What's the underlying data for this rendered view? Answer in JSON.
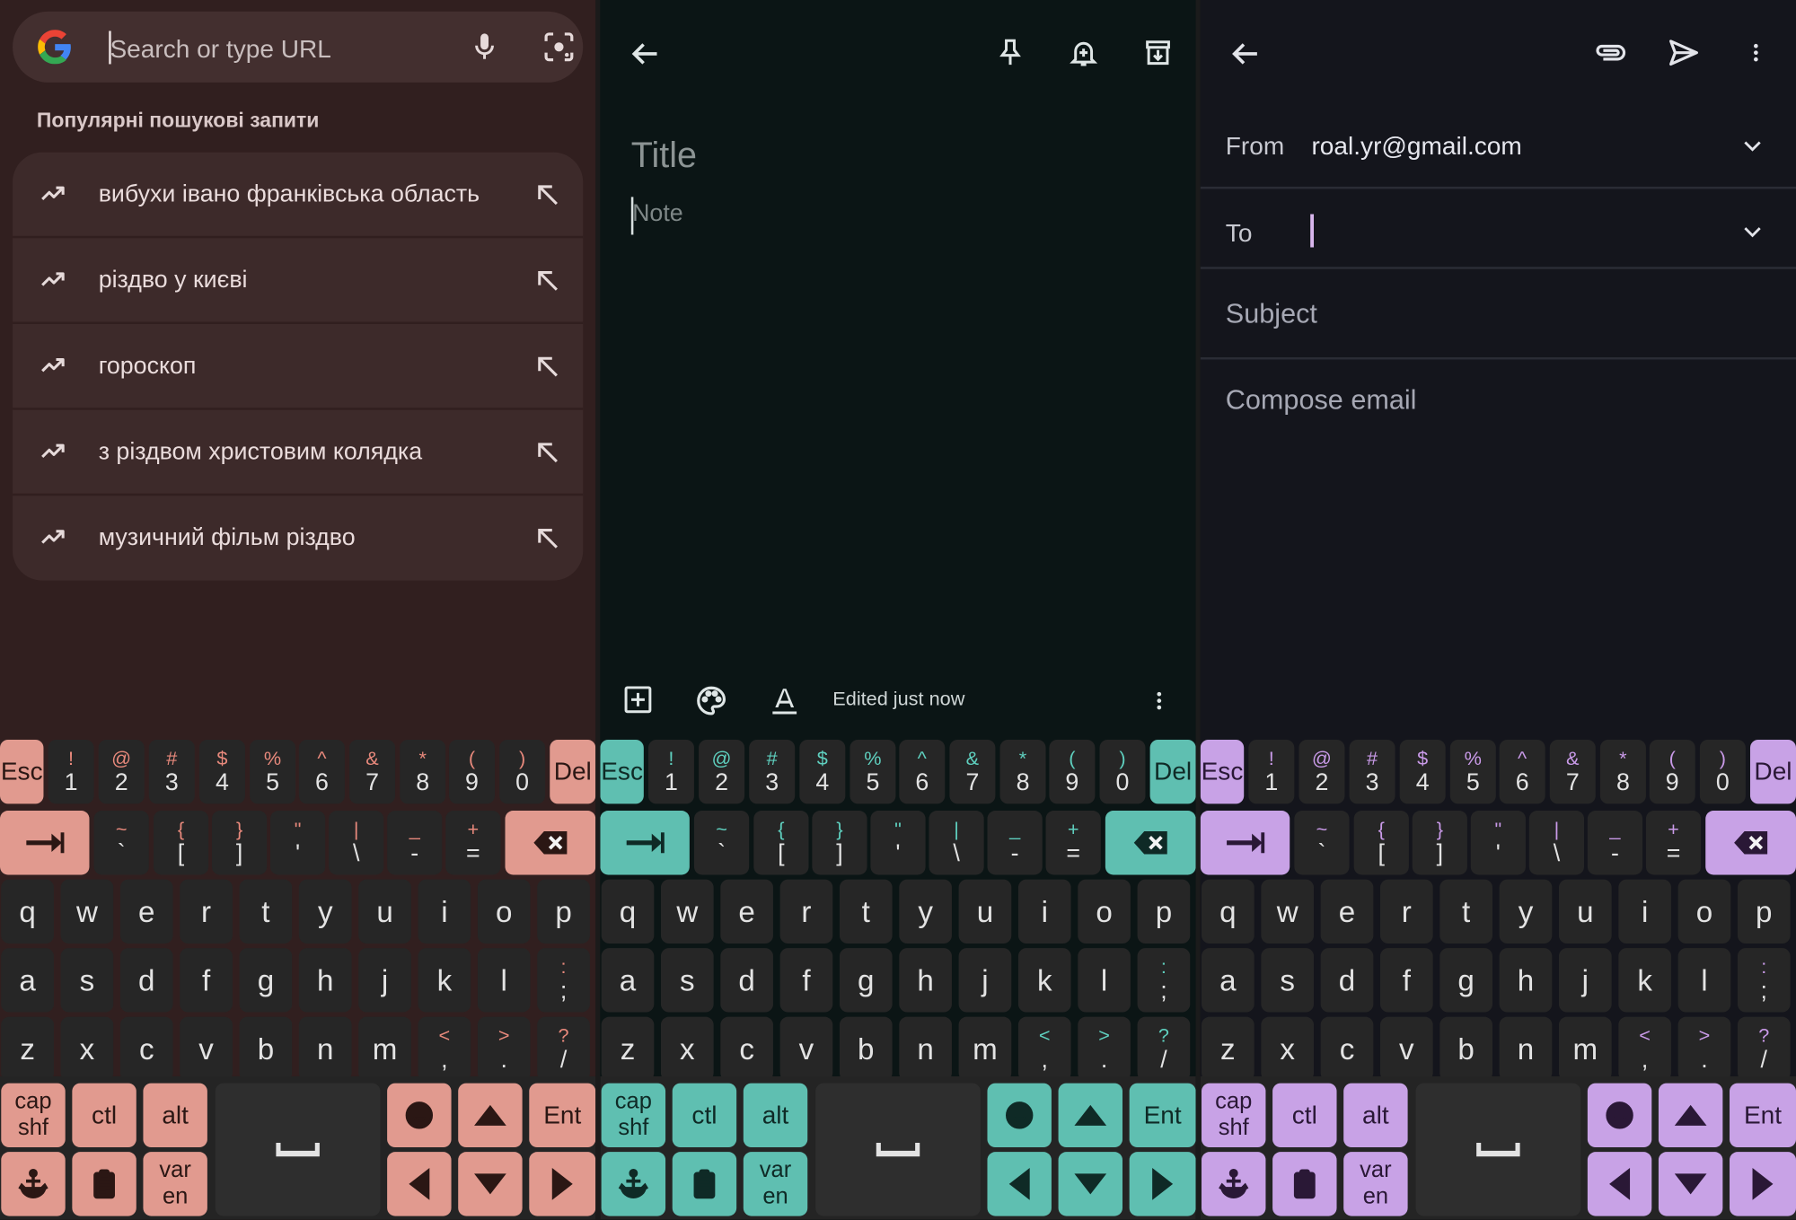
{
  "chrome": {
    "search_placeholder": "Search or type URL",
    "suggestions_heading": "Популярні пошукові запити",
    "suggestions": [
      {
        "label": "вибухи івано франківська область"
      },
      {
        "label": "різдво у києві"
      },
      {
        "label": "гороскоп"
      },
      {
        "label": "з різдвом христовим колядка"
      },
      {
        "label": "музичний фільм різдво"
      }
    ],
    "icons": [
      "google-logo-icon",
      "mic-icon",
      "lens-icon",
      "trending-icon",
      "fill-arrow-icon"
    ]
  },
  "keep": {
    "title_placeholder": "Title",
    "note_placeholder": "Note",
    "edited_status": "Edited just now",
    "icons": [
      "back-icon",
      "pin-icon",
      "reminder-icon",
      "archive-icon",
      "add-box-icon",
      "palette-icon",
      "text-format-icon",
      "more-icon"
    ]
  },
  "gmail": {
    "from_label": "From",
    "from_value": "roal.yr@gmail.com",
    "to_label": "To",
    "subject_placeholder": "Subject",
    "compose_placeholder": "Compose email",
    "icons": [
      "back-icon",
      "attach-icon",
      "send-icon",
      "more-icon",
      "chevron-down-icon"
    ]
  },
  "keyboard": {
    "themes": {
      "t1": {
        "accent": "#e19a8f"
      },
      "t2": {
        "accent": "#5fbfb1"
      },
      "t3": {
        "accent": "#c8a2e6"
      }
    },
    "esc_label": "Esc",
    "del_label": "Del",
    "number_row": [
      {
        "top": "!",
        "bottom": "1"
      },
      {
        "top": "@",
        "bottom": "2"
      },
      {
        "top": "#",
        "bottom": "3"
      },
      {
        "top": "$",
        "bottom": "4"
      },
      {
        "top": "%",
        "bottom": "5"
      },
      {
        "top": "^",
        "bottom": "6"
      },
      {
        "top": "&",
        "bottom": "7"
      },
      {
        "top": "*",
        "bottom": "8"
      },
      {
        "top": "(",
        "bottom": "9"
      },
      {
        "top": ")",
        "bottom": "0"
      }
    ],
    "symbol_row": [
      {
        "top": "~",
        "bottom": "`"
      },
      {
        "top": "{",
        "bottom": "["
      },
      {
        "top": "}",
        "bottom": "]"
      },
      {
        "top": "\"",
        "bottom": "'"
      },
      {
        "top": "|",
        "bottom": "\\"
      },
      {
        "top": "_",
        "bottom": "-"
      },
      {
        "top": "+",
        "bottom": "="
      }
    ],
    "row_q": [
      "q",
      "w",
      "e",
      "r",
      "t",
      "y",
      "u",
      "i",
      "o",
      "p"
    ],
    "row_a": [
      "a",
      "s",
      "d",
      "f",
      "g",
      "h",
      "j",
      "k",
      "l"
    ],
    "row_a_extra": {
      "top": ":",
      "bottom": ";"
    },
    "row_z": [
      "z",
      "x",
      "c",
      "v",
      "b",
      "n",
      "m"
    ],
    "row_z_extra": [
      {
        "top": "<",
        "bottom": ","
      },
      {
        "top": ">",
        "bottom": "."
      },
      {
        "top": "?",
        "bottom": "/"
      }
    ],
    "capshf_top": "cap",
    "capshf_bottom": "shf",
    "ctl_label": "ctl",
    "alt_label": "alt",
    "ent_label": "Ent",
    "var_top": "var",
    "var_bottom": "en"
  }
}
